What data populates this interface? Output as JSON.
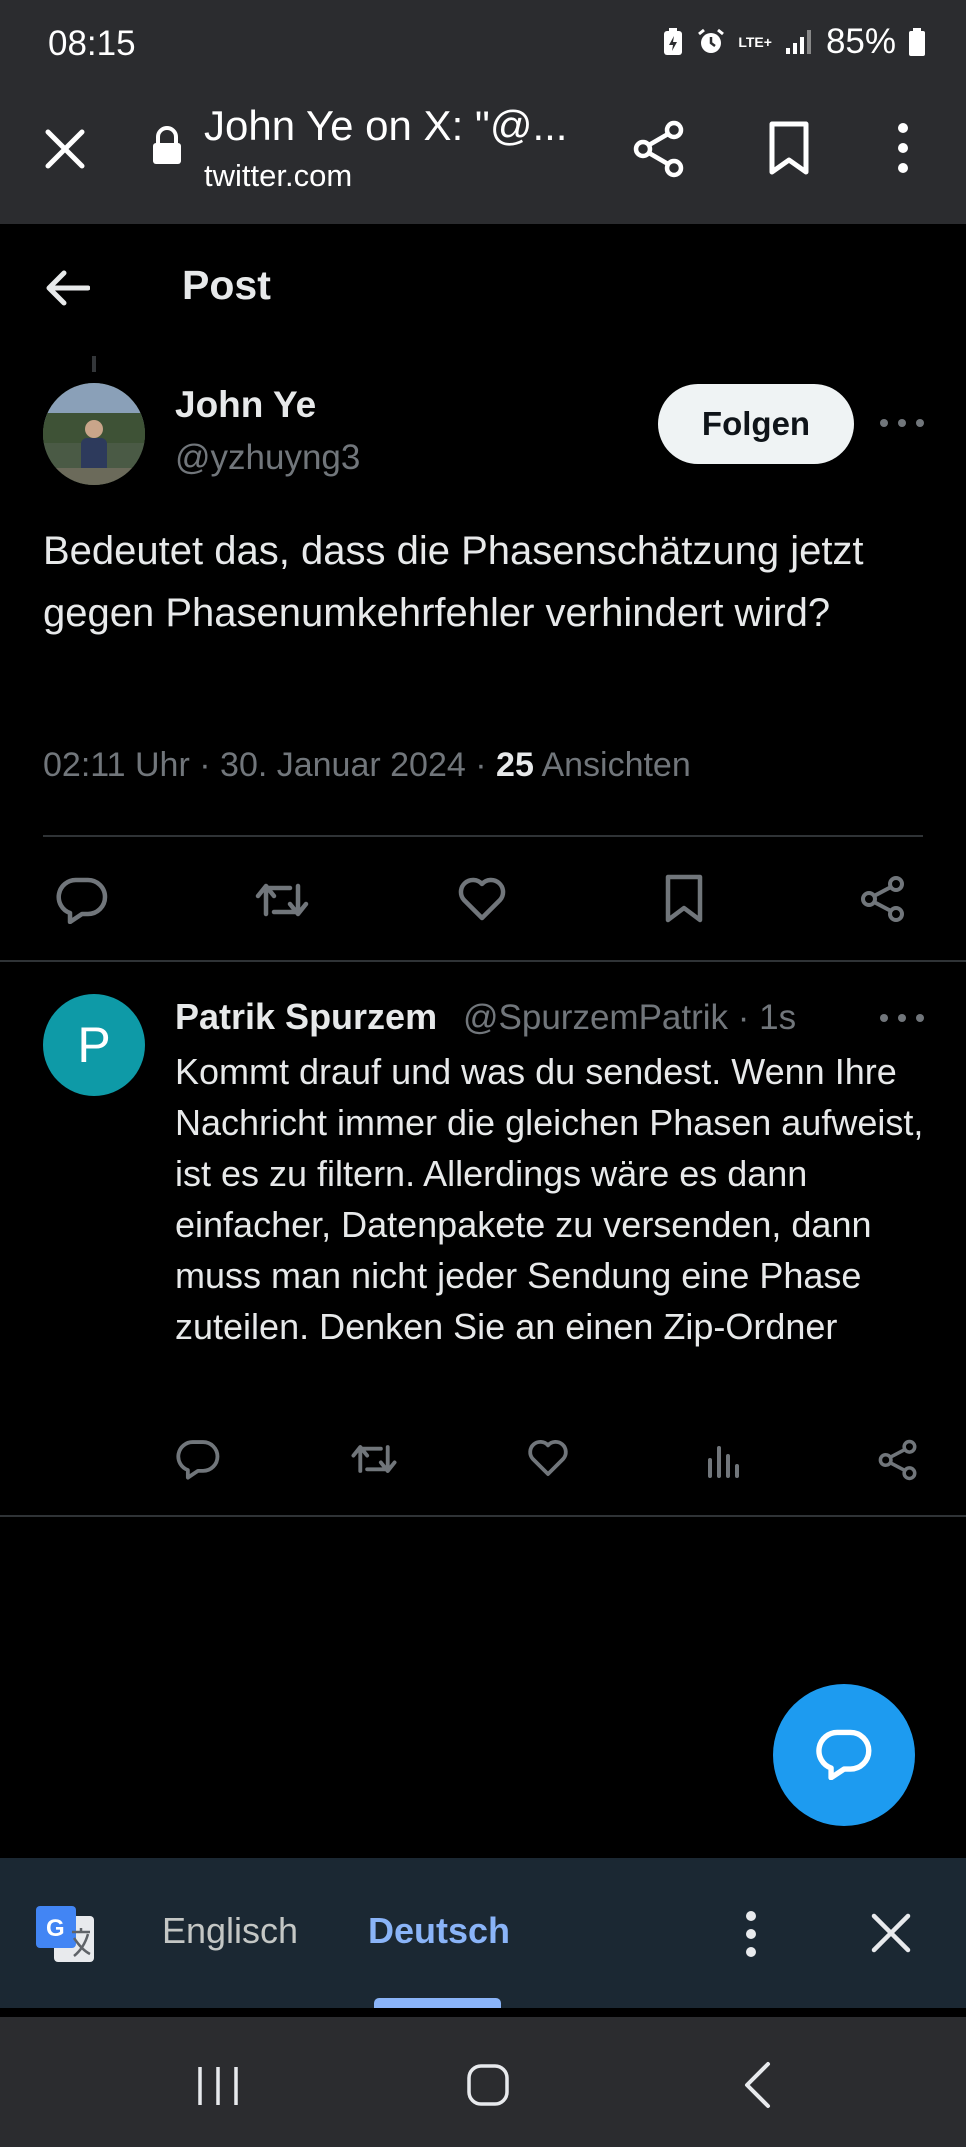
{
  "status_bar": {
    "time": "08:15",
    "network": "LTE+",
    "battery": "85%",
    "icons": [
      "battery-saver-icon",
      "alarm-icon",
      "lte-signal-icon",
      "signal-bars-icon",
      "battery-icon"
    ]
  },
  "browser": {
    "page_title": "John Ye on X: \"@...",
    "url": "twitter.com",
    "icons": [
      "close-icon",
      "lock-icon",
      "share-icon",
      "bookmark-icon",
      "overflow-menu-icon"
    ]
  },
  "header": {
    "title": "Post",
    "back_icon": "back-arrow-icon"
  },
  "post": {
    "author_name": "John Ye",
    "author_handle": "@yzhuyng3",
    "follow_label": "Folgen",
    "text": "Bedeutet das, dass die Phasenschätzung jetzt gegen Phasenumkehrfehler verhindert wird?",
    "time": "02:11 Uhr",
    "date": "30. Januar 2024",
    "views_count": "25",
    "views_label": "Ansichten",
    "separator": "·",
    "actions": [
      "reply-icon",
      "repost-icon",
      "like-icon",
      "bookmark-icon",
      "share-icon"
    ]
  },
  "reply": {
    "avatar_letter": "P",
    "author_name": "Patrik Spurzem",
    "author_handle": "@SpurzemPatrik",
    "time": "1s",
    "separator": "·",
    "text": "Kommt drauf und was du sendest. Wenn Ihre Nachricht immer die gleichen Phasen aufweist, ist es zu filtern. Allerdings wäre es dann einfacher, Datenpakete zu versenden, dann muss man nicht jeder Sendung eine Phase zuteilen. Denken Sie an einen Zip-Ordner",
    "actions": [
      "reply-icon",
      "repost-icon",
      "like-icon",
      "views-analytics-icon",
      "share-icon"
    ]
  },
  "fab": {
    "icon": "compose-reply-icon",
    "color": "#1d9bf0"
  },
  "translate_bar": {
    "source_language": "Englisch",
    "target_language": "Deutsch",
    "selected": "Deutsch",
    "icons": [
      "google-translate-icon",
      "overflow-menu-icon",
      "close-icon"
    ]
  },
  "nav_bar": {
    "icons": [
      "recent-apps-icon",
      "home-icon",
      "back-icon"
    ]
  },
  "colors": {
    "background": "#000000",
    "chrome": "#2b2c2f",
    "primary_text": "#e7e9ea",
    "secondary_text": "#71767b",
    "accent": "#1d9bf0",
    "translate_bar": "#1b2833",
    "translate_accent": "#8ab4f8"
  }
}
